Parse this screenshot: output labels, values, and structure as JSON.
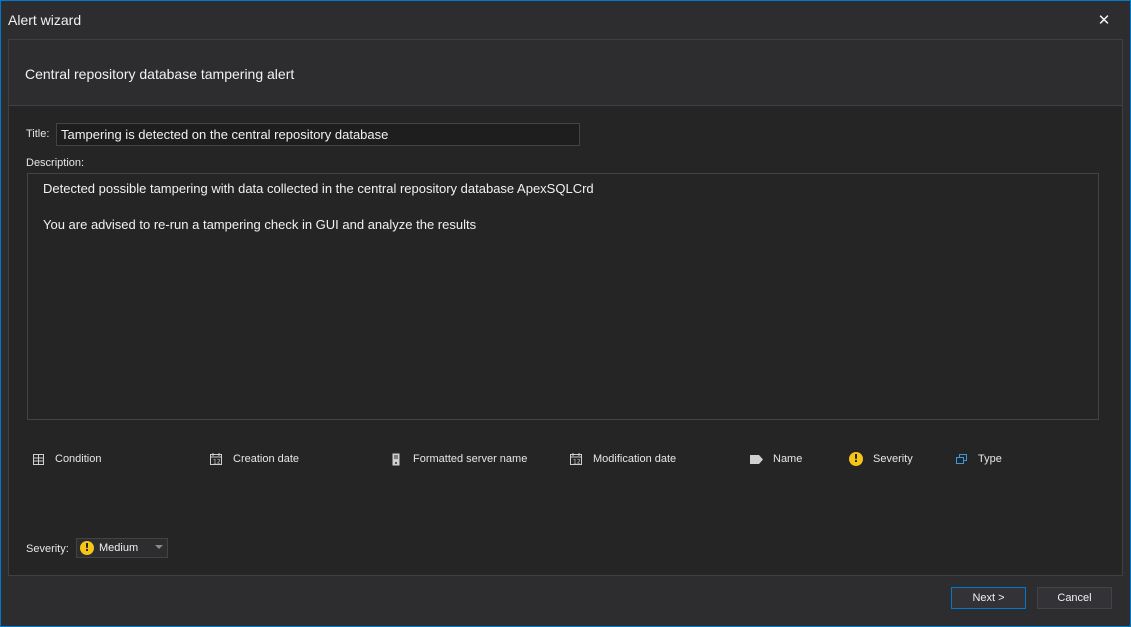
{
  "window": {
    "title": "Alert wizard",
    "close_label": "✕",
    "accent_color": "#007acc"
  },
  "header": {
    "text": "Central repository database tampering alert"
  },
  "form": {
    "title_label": "Title:",
    "title_value": "Tampering is detected on the central repository database",
    "description_label": "Description:",
    "description_lines": [
      "Detected possible tampering with data collected in the central repository database ApexSQLCrd",
      "You are advised to re-run a tampering check in GUI and analyze the results"
    ],
    "severity_label": "Severity:",
    "severity_value": "Medium",
    "severity_icon": "warning-icon"
  },
  "tokens": [
    {
      "label": "Condition",
      "icon": "grid-icon"
    },
    {
      "label": "Creation date",
      "icon": "calendar-icon"
    },
    {
      "label": "Formatted server name",
      "icon": "server-icon"
    },
    {
      "label": "Modification date",
      "icon": "calendar-icon"
    },
    {
      "label": "Name",
      "icon": "tag-icon"
    },
    {
      "label": "Severity",
      "icon": "warning-icon"
    },
    {
      "label": "Type",
      "icon": "copy-icon"
    }
  ],
  "footer": {
    "next_label": "Next >",
    "cancel_label": "Cancel"
  }
}
